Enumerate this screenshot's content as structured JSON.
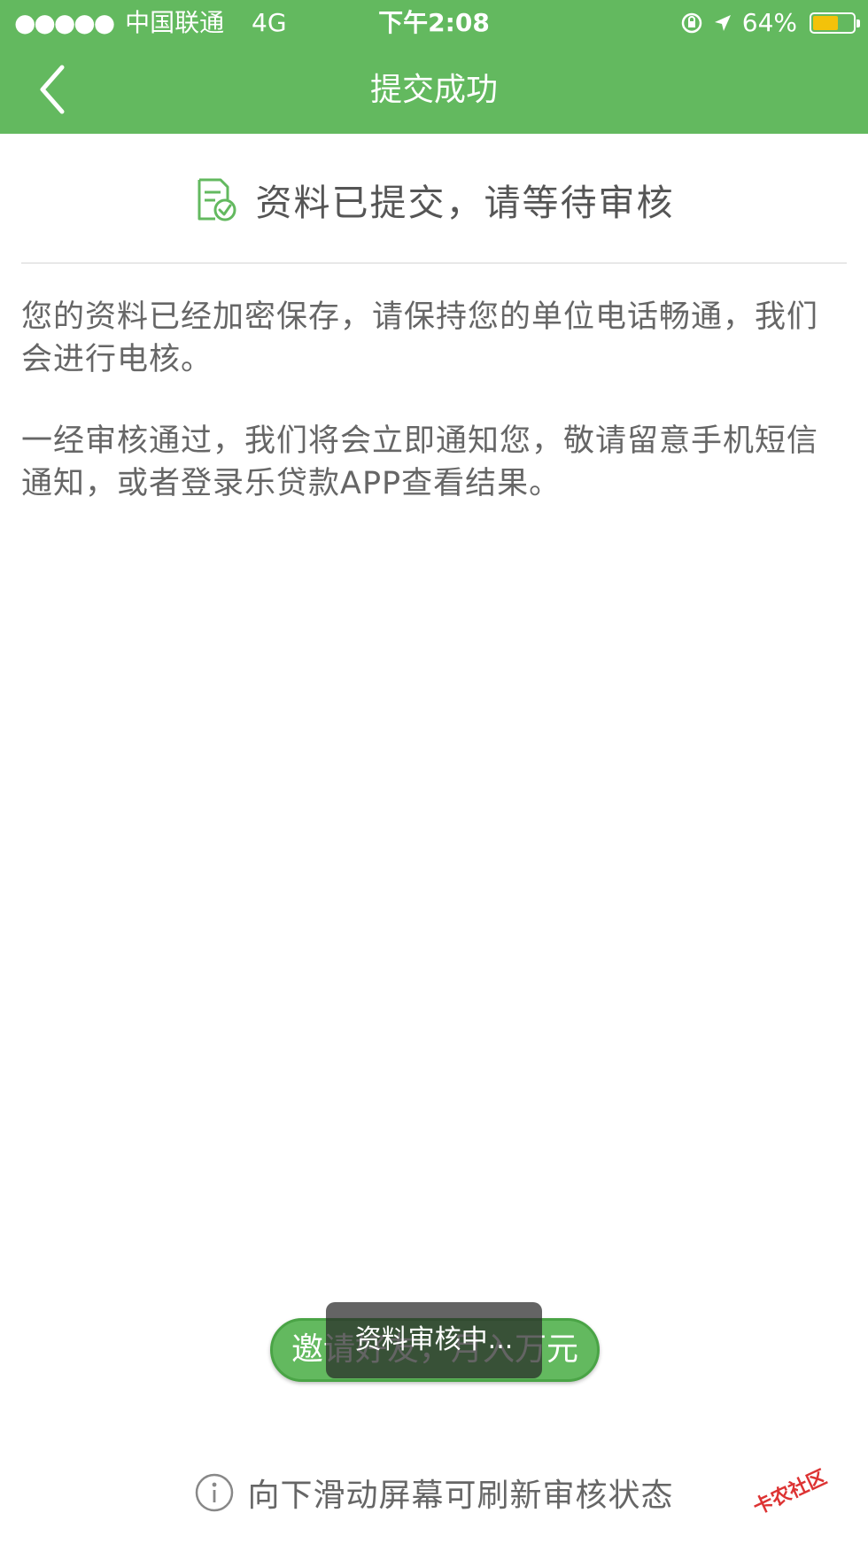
{
  "status_bar": {
    "signal": "●●●●●",
    "carrier": "中国联通",
    "network": "4G",
    "time": "下午2:08",
    "battery": "64%",
    "battery_level": 0.64,
    "battery_color": "#f3c20a"
  },
  "navbar": {
    "title": "提交成功",
    "back_icon": "chevron-left-icon",
    "background": "#63b95f"
  },
  "header": {
    "icon": "document-check-icon",
    "title": "资料已提交，请等待审核"
  },
  "content": {
    "paragraph1": "您的资料已经加密保存，请保持您的单位电话畅通，我们会进行电核。",
    "paragraph2": "一经审核通过，我们将会立即通知您，敬请留意手机短信通知，或者登录乐贷款APP查看结果。"
  },
  "invite_button": {
    "label": "邀请好友，月入万元"
  },
  "toast": {
    "text": "资料审核中..."
  },
  "hint": {
    "icon": "info-icon",
    "text": "向下滑动屏幕可刷新审核状态"
  },
  "watermark": {
    "text": "卡农社区"
  }
}
